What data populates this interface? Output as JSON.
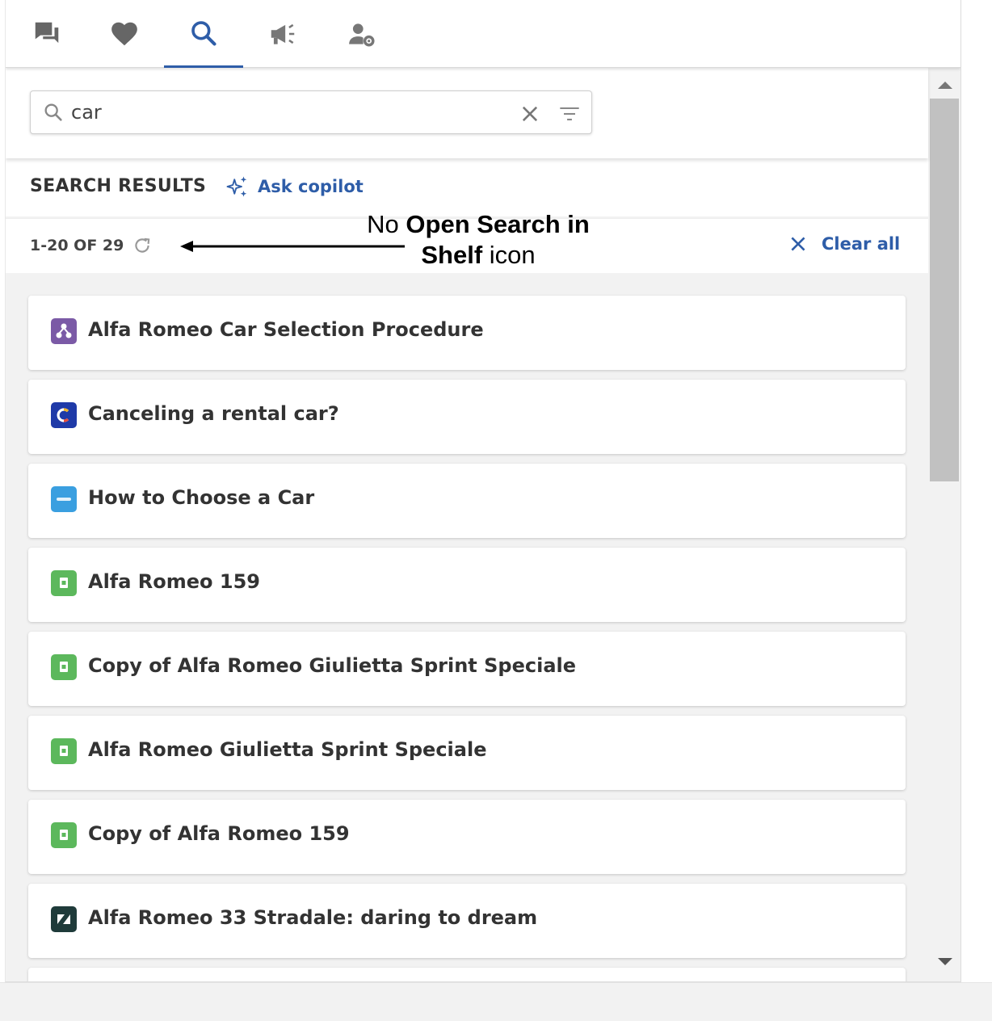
{
  "nav": {
    "tabs": [
      {
        "icon": "chat-icon"
      },
      {
        "icon": "heart-icon"
      },
      {
        "icon": "search-icon",
        "active": true
      },
      {
        "icon": "megaphone-icon"
      },
      {
        "icon": "user-settings-icon"
      }
    ]
  },
  "search": {
    "value": "car"
  },
  "results": {
    "title": "SEARCH RESULTS",
    "copilot_label": "Ask copilot",
    "count": "1-20 OF 29",
    "clear_all_label": "Clear all"
  },
  "annotation": {
    "part1": "No ",
    "part2": "Open Search in",
    "part3": "Shelf",
    "part4": " icon"
  },
  "items": [
    {
      "title": "Alfa Romeo Car Selection Procedure",
      "source_icon": "workflow-icon",
      "color": "#7b5aa6"
    },
    {
      "title": "Canceling a rental car?",
      "source_icon": "c-logo-icon",
      "color": "#1f3aa8"
    },
    {
      "title": "How to Choose a Car",
      "source_icon": "salesforce-icon",
      "color": "#3a9fe0"
    },
    {
      "title": "Alfa Romeo 159",
      "source_icon": "document-icon",
      "color": "#5cb85c"
    },
    {
      "title": "Copy of Alfa Romeo Giulietta Sprint Speciale",
      "source_icon": "document-icon",
      "color": "#5cb85c"
    },
    {
      "title": "Alfa Romeo Giulietta Sprint Speciale",
      "source_icon": "document-icon",
      "color": "#5cb85c"
    },
    {
      "title": "Copy of Alfa Romeo 159",
      "source_icon": "document-icon",
      "color": "#5cb85c"
    },
    {
      "title": "Alfa Romeo 33 Stradale: daring to dream",
      "source_icon": "zendesk-icon",
      "color": "#1f3b3a"
    }
  ],
  "colors": {
    "accent": "#2e5da8",
    "icon_gray": "#777777"
  }
}
